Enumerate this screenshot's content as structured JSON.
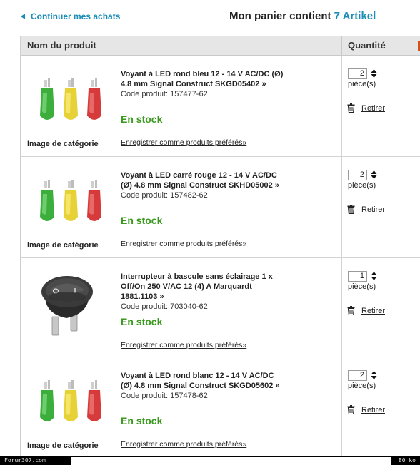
{
  "header": {
    "continue_label": "Continuer mes achats",
    "cart_prefix": "Mon panier contient",
    "cart_count": "7 Artikel"
  },
  "table": {
    "col_name": "Nom du produit",
    "col_qty": "Quantité"
  },
  "items": [
    {
      "title": "Voyant à LED rond bleu 12 - 14 V AC/DC (Ø) 4.8 mm Signal Construct SKGD05402 »",
      "code": "Code produit: 157477-62",
      "stock": "En stock",
      "save": "Enregistrer comme produits préférés»",
      "image_label": "Image de catégorie",
      "qty": "2",
      "unit": "pièce(s)",
      "remove": "Retirer",
      "image": "led-indicators"
    },
    {
      "title": "Voyant à LED carré rouge 12 - 14 V AC/DC (Ø) 4.8 mm Signal Construct SKHD05002 »",
      "code": "Code produit: 157482-62",
      "stock": "En stock",
      "save": "Enregistrer comme produits préférés»",
      "image_label": "Image de catégorie",
      "qty": "2",
      "unit": "pièce(s)",
      "remove": "Retirer",
      "image": "led-indicators"
    },
    {
      "title": "Interrupteur à bascule sans éclairage 1 x Off/On 250 V/AC 12 (4) A Marquardt 1881.1103 »",
      "code": "Code produit: 703040-62",
      "stock": "En stock",
      "save": "Enregistrer comme produits préférés»",
      "image_label": "",
      "qty": "1",
      "unit": "pièce(s)",
      "remove": "Retirer",
      "image": "rocker-switch"
    },
    {
      "title": "Voyant à LED rond blanc 12 - 14 V AC/DC (Ø) 4.8 mm Signal Construct SKGD05602 »",
      "code": "Code produit: 157478-62",
      "stock": "En stock",
      "save": "Enregistrer comme produits préférés»",
      "image_label": "Image de catégorie",
      "qty": "2",
      "unit": "pièce(s)",
      "remove": "Retirer",
      "image": "led-indicators"
    }
  ],
  "footer": {
    "left": "Forum307.com",
    "right": "80 ko"
  },
  "colors": {
    "link": "#1a8cb5",
    "stock": "#3a9a1e"
  }
}
